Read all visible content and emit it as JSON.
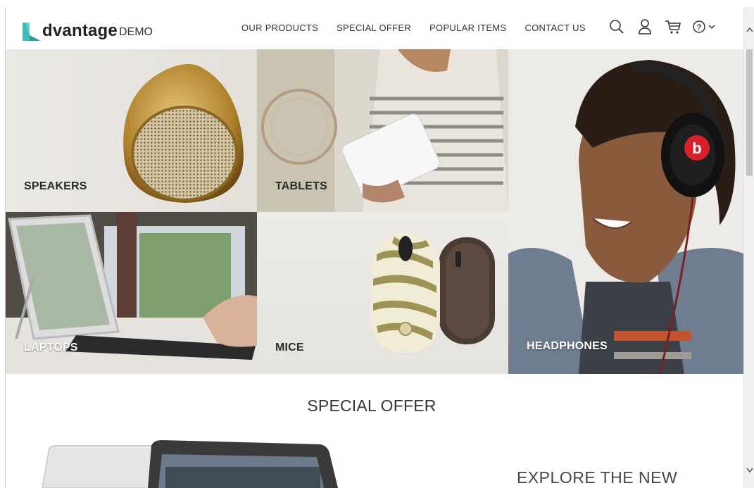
{
  "header": {
    "logo_brand": "dvantage",
    "logo_demo": "DEMO",
    "nav": [
      "OUR PRODUCTS",
      "SPECIAL OFFER",
      "POPULAR ITEMS",
      "CONTACT US"
    ]
  },
  "categories": {
    "speakers": "SPEAKERS",
    "tablets": "TABLETS",
    "laptops": "LAPTOPS",
    "mice": "MICE",
    "headphones": "HEADPHONES"
  },
  "special_offer": {
    "title": "SPECIAL OFFER",
    "explore": "EXPLORE THE NEW"
  },
  "colors": {
    "accent": "#3bbfb3",
    "text": "#333333"
  },
  "icons": [
    "search-icon",
    "user-icon",
    "cart-icon",
    "help-icon",
    "chevron-down-icon"
  ]
}
